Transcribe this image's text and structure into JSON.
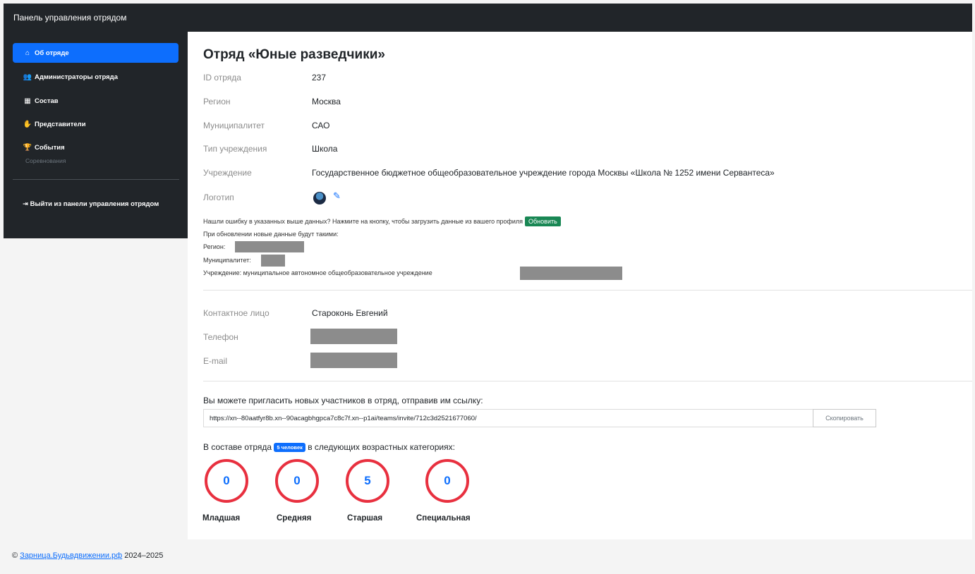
{
  "header": {
    "brand": "Панель управления отрядом"
  },
  "sidebar": {
    "items": [
      {
        "label": "Об отряде",
        "icon": "home-icon",
        "glyph": "⌂"
      },
      {
        "label": "Администраторы отряда",
        "icon": "users-icon",
        "glyph": "👥"
      },
      {
        "label": "Состав",
        "icon": "people-group-icon",
        "glyph": "▦"
      },
      {
        "label": "Представители",
        "icon": "handshake-icon",
        "glyph": "✋"
      },
      {
        "label": "События",
        "icon": "trophy-icon",
        "glyph": "🏆"
      }
    ],
    "events_sub": "Соревнования",
    "logout_glyph": "⇥",
    "logout_label": "Выйти из панели управления отрядом"
  },
  "team": {
    "title": "Отряд «Юные разведчики»",
    "fields": [
      {
        "label": "ID отряда",
        "value": "237"
      },
      {
        "label": "Регион",
        "value": "Москва"
      },
      {
        "label": "Муниципалитет",
        "value": "САО"
      },
      {
        "label": "Тип учреждения",
        "value": "Школа"
      },
      {
        "label": "Учреждение",
        "value": "Государственное бюджетное общеобразовательное учреждение города Москвы «Школа № 1252 имени Сервантеса»"
      }
    ],
    "logo_label": "Логотип"
  },
  "update": {
    "prompt": "Нашли ошибку в указанных выше данных? Нажмите на кнопку, чтобы загрузить данные из вашего профиля",
    "button": "Обновить",
    "new_data_title": "При обновлении новые данные будут такими:",
    "region_label": "Регион:",
    "municipality_label": "Муниципалитет:",
    "institution_label": "Учреждение: муниципальное автономное общеобразовательное учреждение"
  },
  "contacts": {
    "contact_label": "Контактное лицо",
    "contact_value": "Староконь Евгений",
    "phone_label": "Телефон",
    "email_label": "E-mail"
  },
  "invite": {
    "text": "Вы можете пригласить новых участников в отряд, отправив им ссылку:",
    "link": "https://xn--80aatfyr8b.xn--90acagbhgpca7c8c7f.xn--p1ai/teams/invite/712c3d2521677060/",
    "copy_button": "Скопировать"
  },
  "members": {
    "prefix": "В составе отряда",
    "badge": "5 человек",
    "suffix": "в следующих возрастных категориях:",
    "categories": [
      {
        "name": "Младшая",
        "count": "0"
      },
      {
        "name": "Средняя",
        "count": "0"
      },
      {
        "name": "Старшая",
        "count": "5"
      },
      {
        "name": "Специальная",
        "count": "0"
      }
    ]
  },
  "footer": {
    "copyright": "©",
    "link": "Зарница.Будьвдвижении.рф",
    "years": "2024–2025"
  },
  "colors": {
    "sidebar_bg": "#212529",
    "active_bg": "#0d6efd",
    "success": "#198754",
    "circle_border": "#e8303f"
  }
}
